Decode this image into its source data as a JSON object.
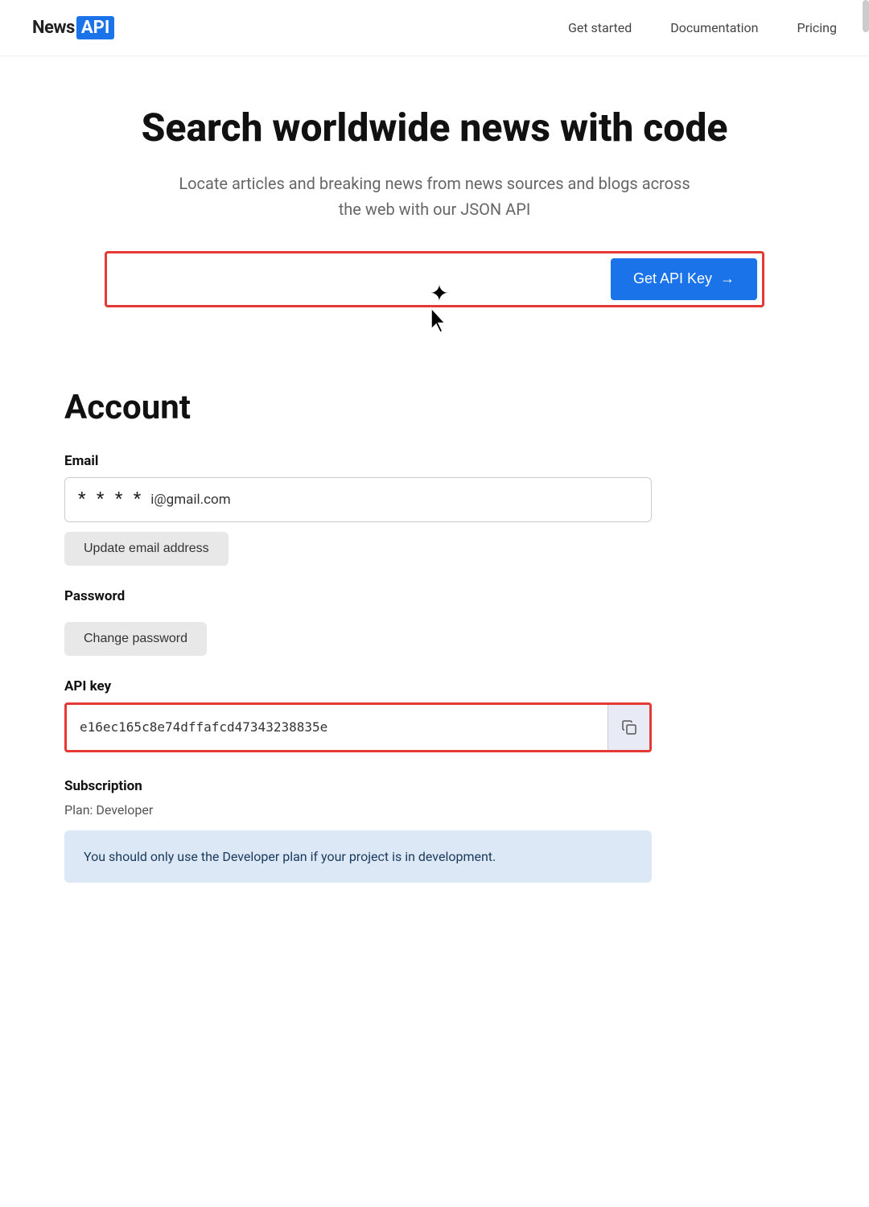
{
  "navbar": {
    "logo_news": "News",
    "logo_api": "API",
    "links": [
      {
        "label": "Get started",
        "id": "get-started"
      },
      {
        "label": "Documentation",
        "id": "documentation"
      },
      {
        "label": "Pricing",
        "id": "pricing"
      }
    ]
  },
  "hero": {
    "title": "Search worldwide news with code",
    "subtitle": "Locate articles and breaking news from news sources and blogs across the web with our JSON API",
    "cta_button": "Get API Key →",
    "cta_button_label": "Get API Key",
    "cta_arrow": "→"
  },
  "account": {
    "section_title": "Account",
    "email_label": "Email",
    "email_asterisks": "* * * *",
    "email_partial": "i@gmail.com",
    "update_email_btn": "Update email address",
    "password_label": "Password",
    "change_password_btn": "Change password",
    "api_key_label": "API key",
    "api_key_value": "e16ec165c8e74dffafcd47343238835e",
    "subscription_label": "Subscription",
    "plan_label": "Plan: Developer",
    "info_box_text": "You should only use the Developer plan if your project is in development."
  }
}
